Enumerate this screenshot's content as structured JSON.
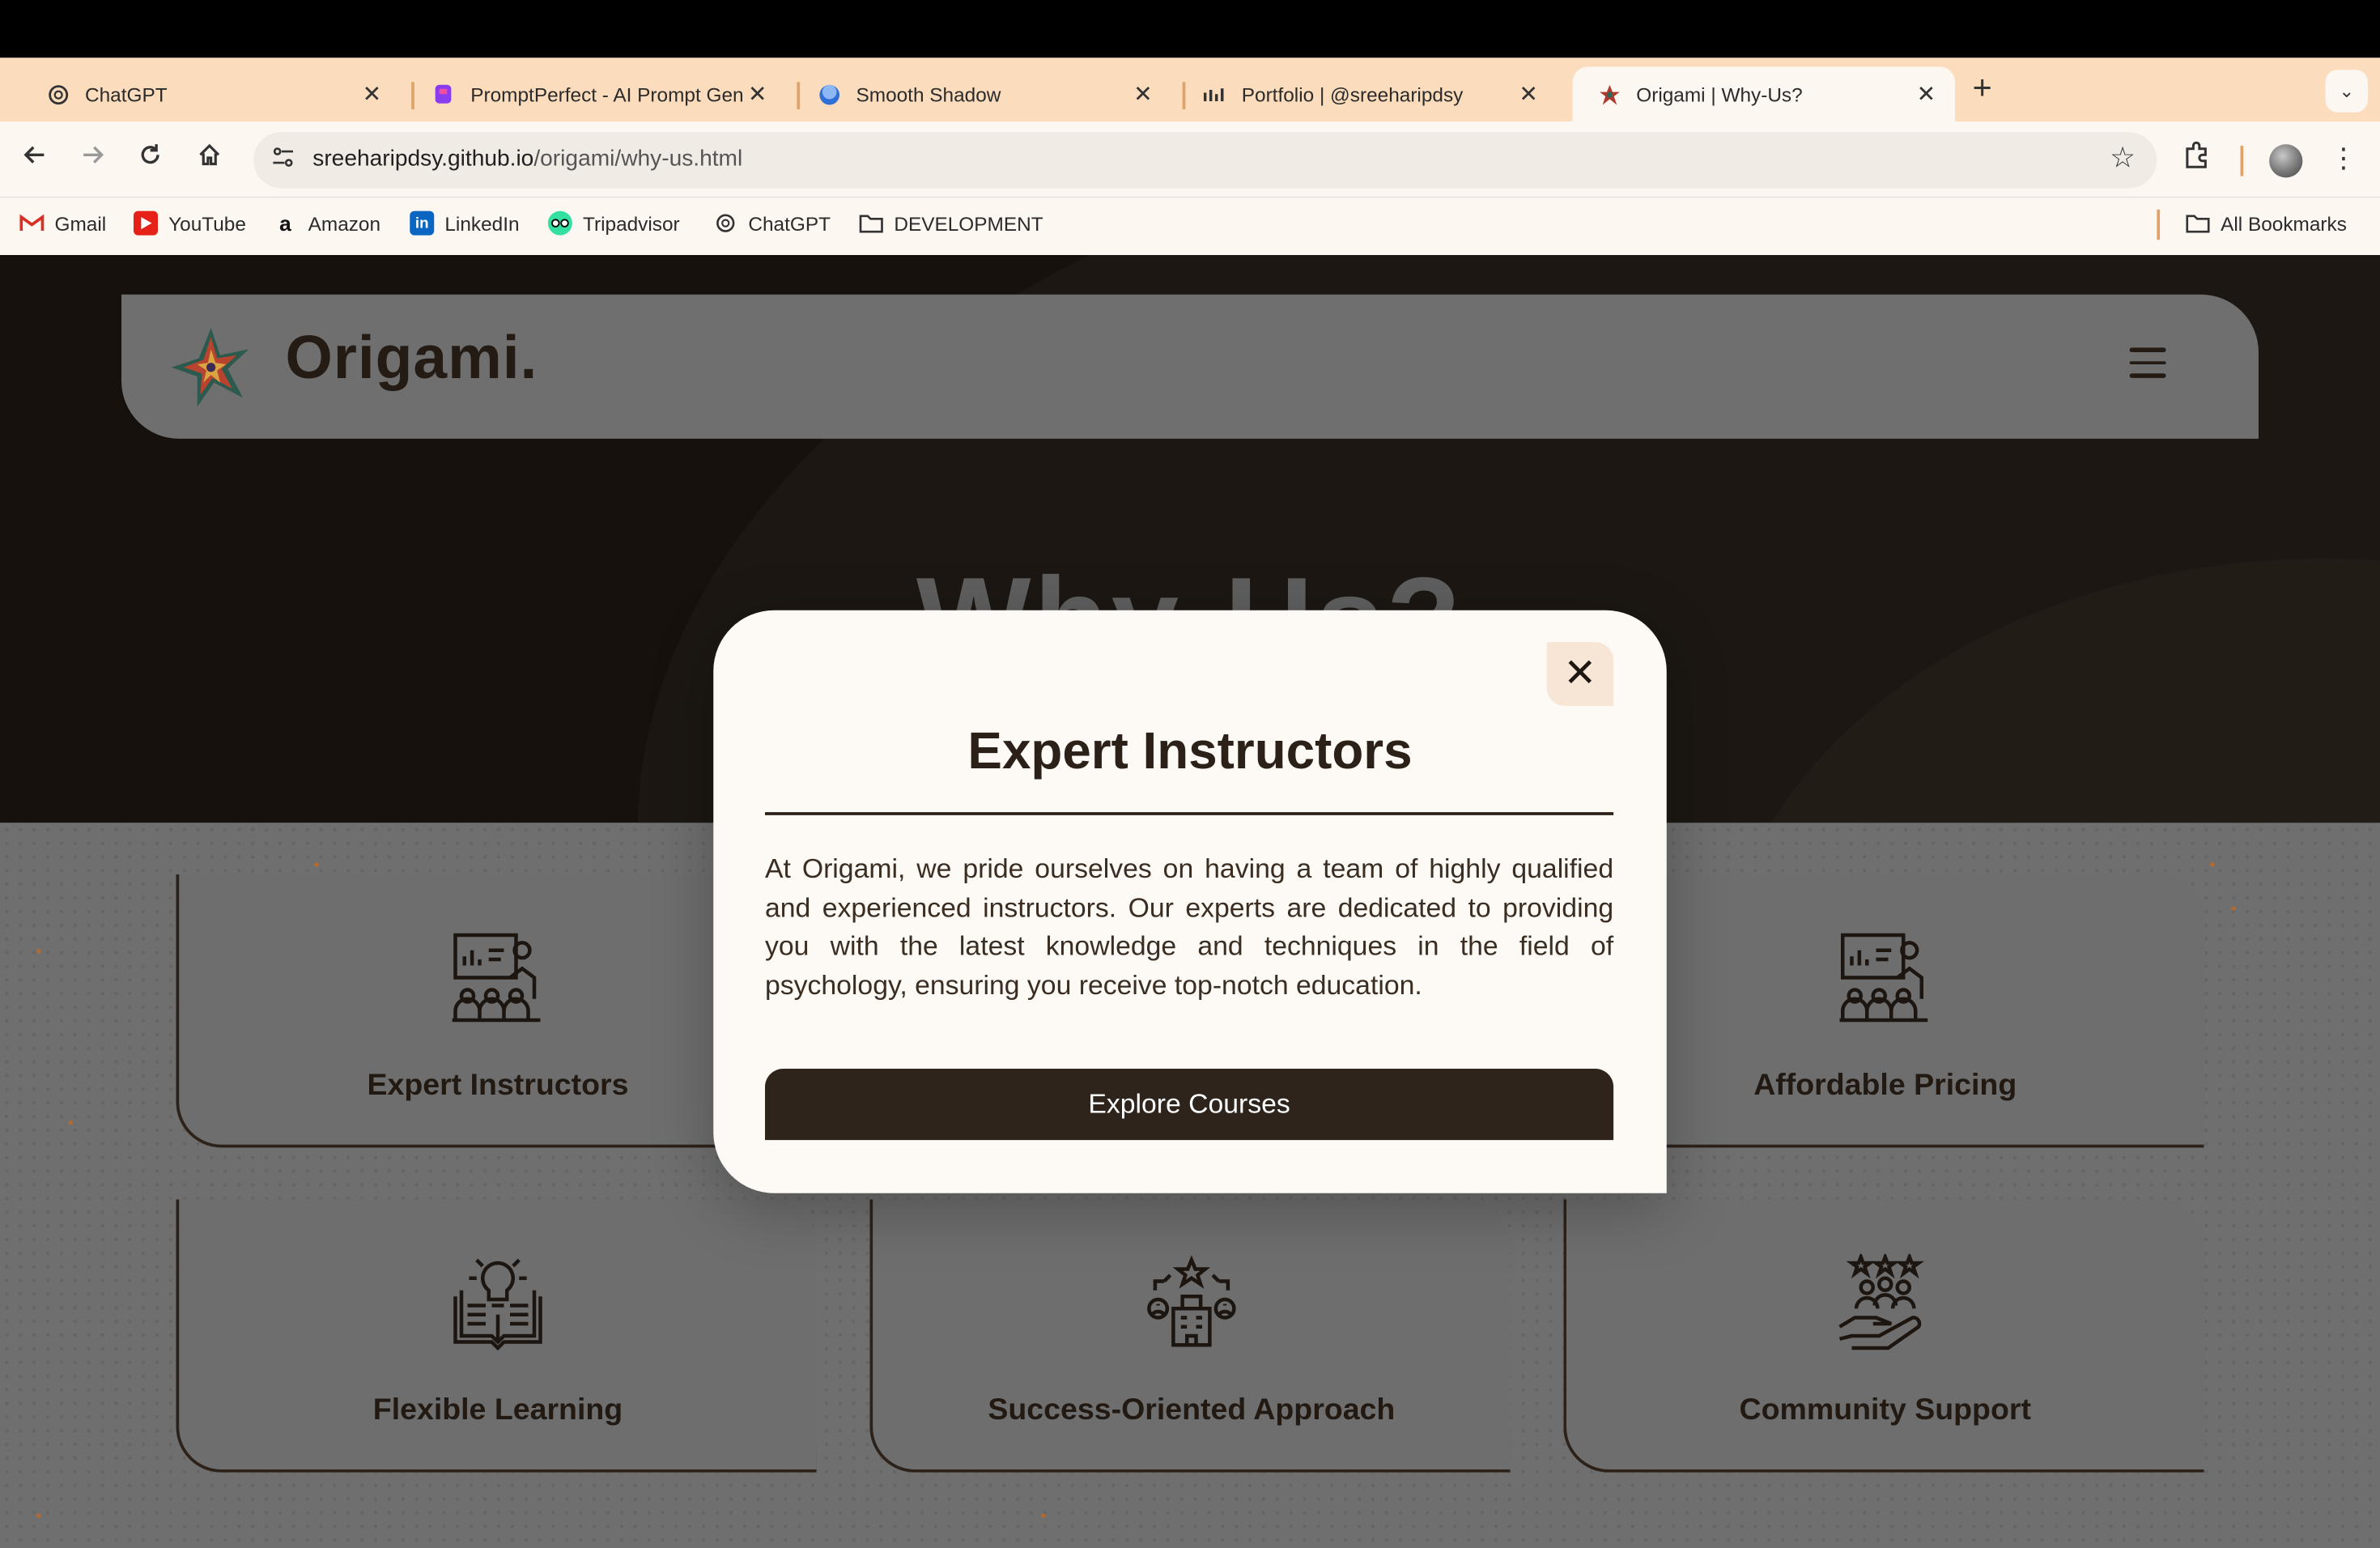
{
  "browser": {
    "tabs": [
      {
        "title": "ChatGPT",
        "icon": "chatgpt-icon"
      },
      {
        "title": "PromptPerfect - AI Prompt Generator",
        "icon": "promptperfect-icon"
      },
      {
        "title": "Smooth Shadow",
        "icon": "smooth-shadow-icon"
      },
      {
        "title": "Portfolio | @sreeharipdsy",
        "icon": "portfolio-icon"
      },
      {
        "title": "Origami | Why-Us?",
        "icon": "origami-icon",
        "active": true
      }
    ],
    "new_tab_label": "+",
    "tab_menu_label": "⌄",
    "close_glyph": "✕",
    "url_domain": "sreeharipdsy.github.io",
    "url_path": "/origami/why-us.html",
    "bookmarks": [
      {
        "label": "Gmail",
        "icon": "gmail-icon"
      },
      {
        "label": "YouTube",
        "icon": "youtube-icon"
      },
      {
        "label": "Amazon",
        "icon": "amazon-icon"
      },
      {
        "label": "LinkedIn",
        "icon": "linkedin-icon"
      },
      {
        "label": "Tripadvisor",
        "icon": "tripadvisor-icon"
      },
      {
        "label": "ChatGPT",
        "icon": "chatgpt-icon"
      },
      {
        "label": "DEVELOPMENT",
        "icon": "folder-icon"
      }
    ],
    "all_bookmarks_label": "All Bookmarks",
    "colors": {
      "tabstrip": "#fbdcbc",
      "toolbar": "#fdf7f2"
    }
  },
  "site": {
    "brand": "Origami.",
    "hero_title": "Why-Us?",
    "cards": [
      {
        "label": "Expert Instructors",
        "icon": "instructor-icon"
      },
      {
        "label": "Affordable Pricing",
        "icon": "instructor-icon"
      },
      {
        "label": "Flexible Learning",
        "icon": "lightbulb-book-icon"
      },
      {
        "label": "Success-Oriented Approach",
        "icon": "success-building-icon"
      },
      {
        "label": "Community Support",
        "icon": "community-hand-icon"
      }
    ],
    "colors": {
      "dark": "#16110d",
      "overlay": "#6f6f6f",
      "accent_text": "#2b2119"
    }
  },
  "modal": {
    "close_label": "✕",
    "title": "Expert Instructors",
    "body": "At Origami, we pride ourselves on having a team of highly qualified and experienced instructors. Our experts are dedicated to providing you with the latest knowledge and techniques in the field of psychology, ensuring you receive top-notch education.",
    "button_label": "Explore Courses"
  }
}
